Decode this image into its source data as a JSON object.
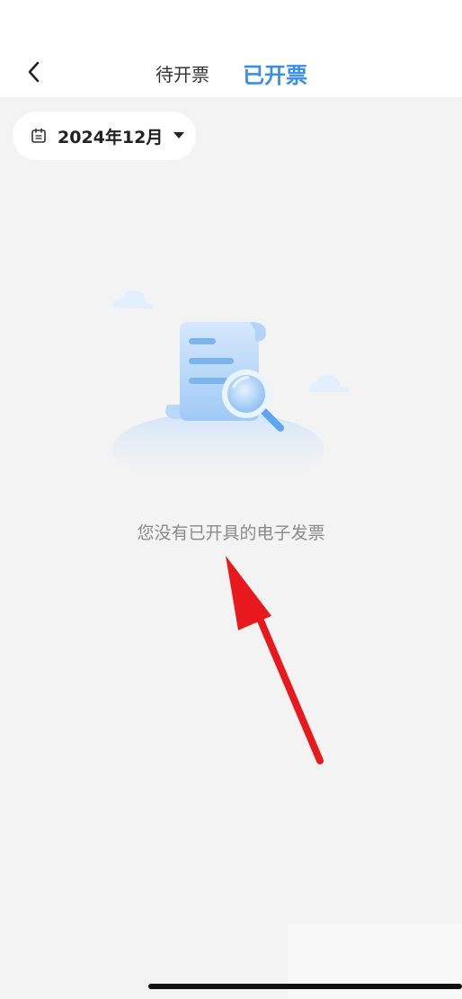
{
  "header": {
    "back_icon": "chevron-left-icon",
    "tabs": [
      {
        "label": "待开票",
        "active": false
      },
      {
        "label": "已开票",
        "active": true
      }
    ],
    "active_color": "#3a8ee6"
  },
  "filter": {
    "month_label": "2024年12月",
    "calendar_icon": "calendar-icon",
    "caret_icon": "caret-down-icon"
  },
  "empty_state": {
    "illustration": "invoice-search-illustration",
    "message": "您没有已开具的电子发票"
  },
  "annotation": {
    "icon": "red-arrow",
    "color": "#e8191c"
  }
}
